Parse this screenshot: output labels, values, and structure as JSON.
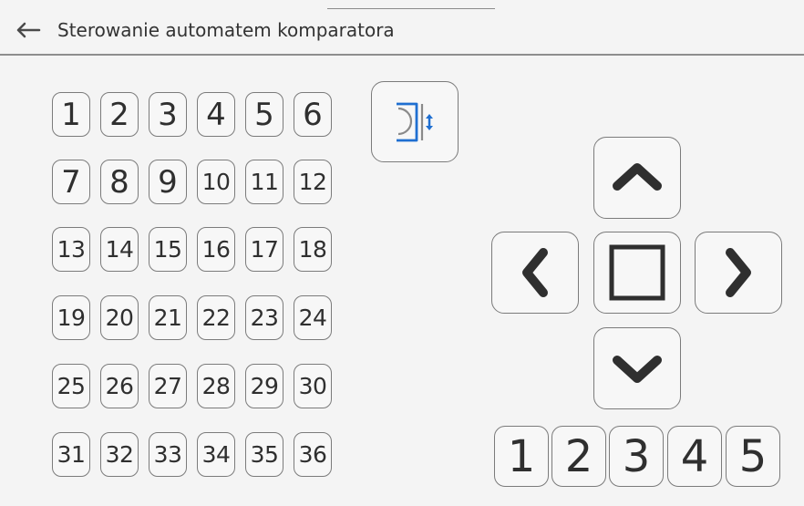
{
  "header": {
    "title": "Sterowanie automatem komparatora",
    "back_icon": "arrow-left-icon"
  },
  "grid": {
    "buttons": [
      {
        "label": "1"
      },
      {
        "label": "2"
      },
      {
        "label": "3"
      },
      {
        "label": "4"
      },
      {
        "label": "5"
      },
      {
        "label": "6"
      },
      {
        "label": "7"
      },
      {
        "label": "8"
      },
      {
        "label": "9"
      },
      {
        "label": "10"
      },
      {
        "label": "11"
      },
      {
        "label": "12"
      },
      {
        "label": "13"
      },
      {
        "label": "14"
      },
      {
        "label": "15"
      },
      {
        "label": "16"
      },
      {
        "label": "17"
      },
      {
        "label": "18"
      },
      {
        "label": "19"
      },
      {
        "label": "20"
      },
      {
        "label": "21"
      },
      {
        "label": "22"
      },
      {
        "label": "23"
      },
      {
        "label": "24"
      },
      {
        "label": "25"
      },
      {
        "label": "26"
      },
      {
        "label": "27"
      },
      {
        "label": "28"
      },
      {
        "label": "29"
      },
      {
        "label": "30"
      },
      {
        "label": "31"
      },
      {
        "label": "32"
      },
      {
        "label": "33"
      },
      {
        "label": "34"
      },
      {
        "label": "35"
      },
      {
        "label": "36"
      }
    ]
  },
  "special_button": {
    "icon": "gripper-vertical-move-icon"
  },
  "controls": {
    "up_icon": "chevron-up-icon",
    "left_icon": "chevron-left-icon",
    "stop_icon": "square-stop-icon",
    "right_icon": "chevron-right-icon",
    "down_icon": "chevron-down-icon"
  },
  "stations": {
    "buttons": [
      {
        "label": "1"
      },
      {
        "label": "2"
      },
      {
        "label": "3"
      },
      {
        "label": "4"
      },
      {
        "label": "5"
      }
    ]
  },
  "colors": {
    "background": "#f4f4f4",
    "border": "#7b7b7b",
    "icon": "#333333",
    "accent": "#1f6fd1"
  }
}
